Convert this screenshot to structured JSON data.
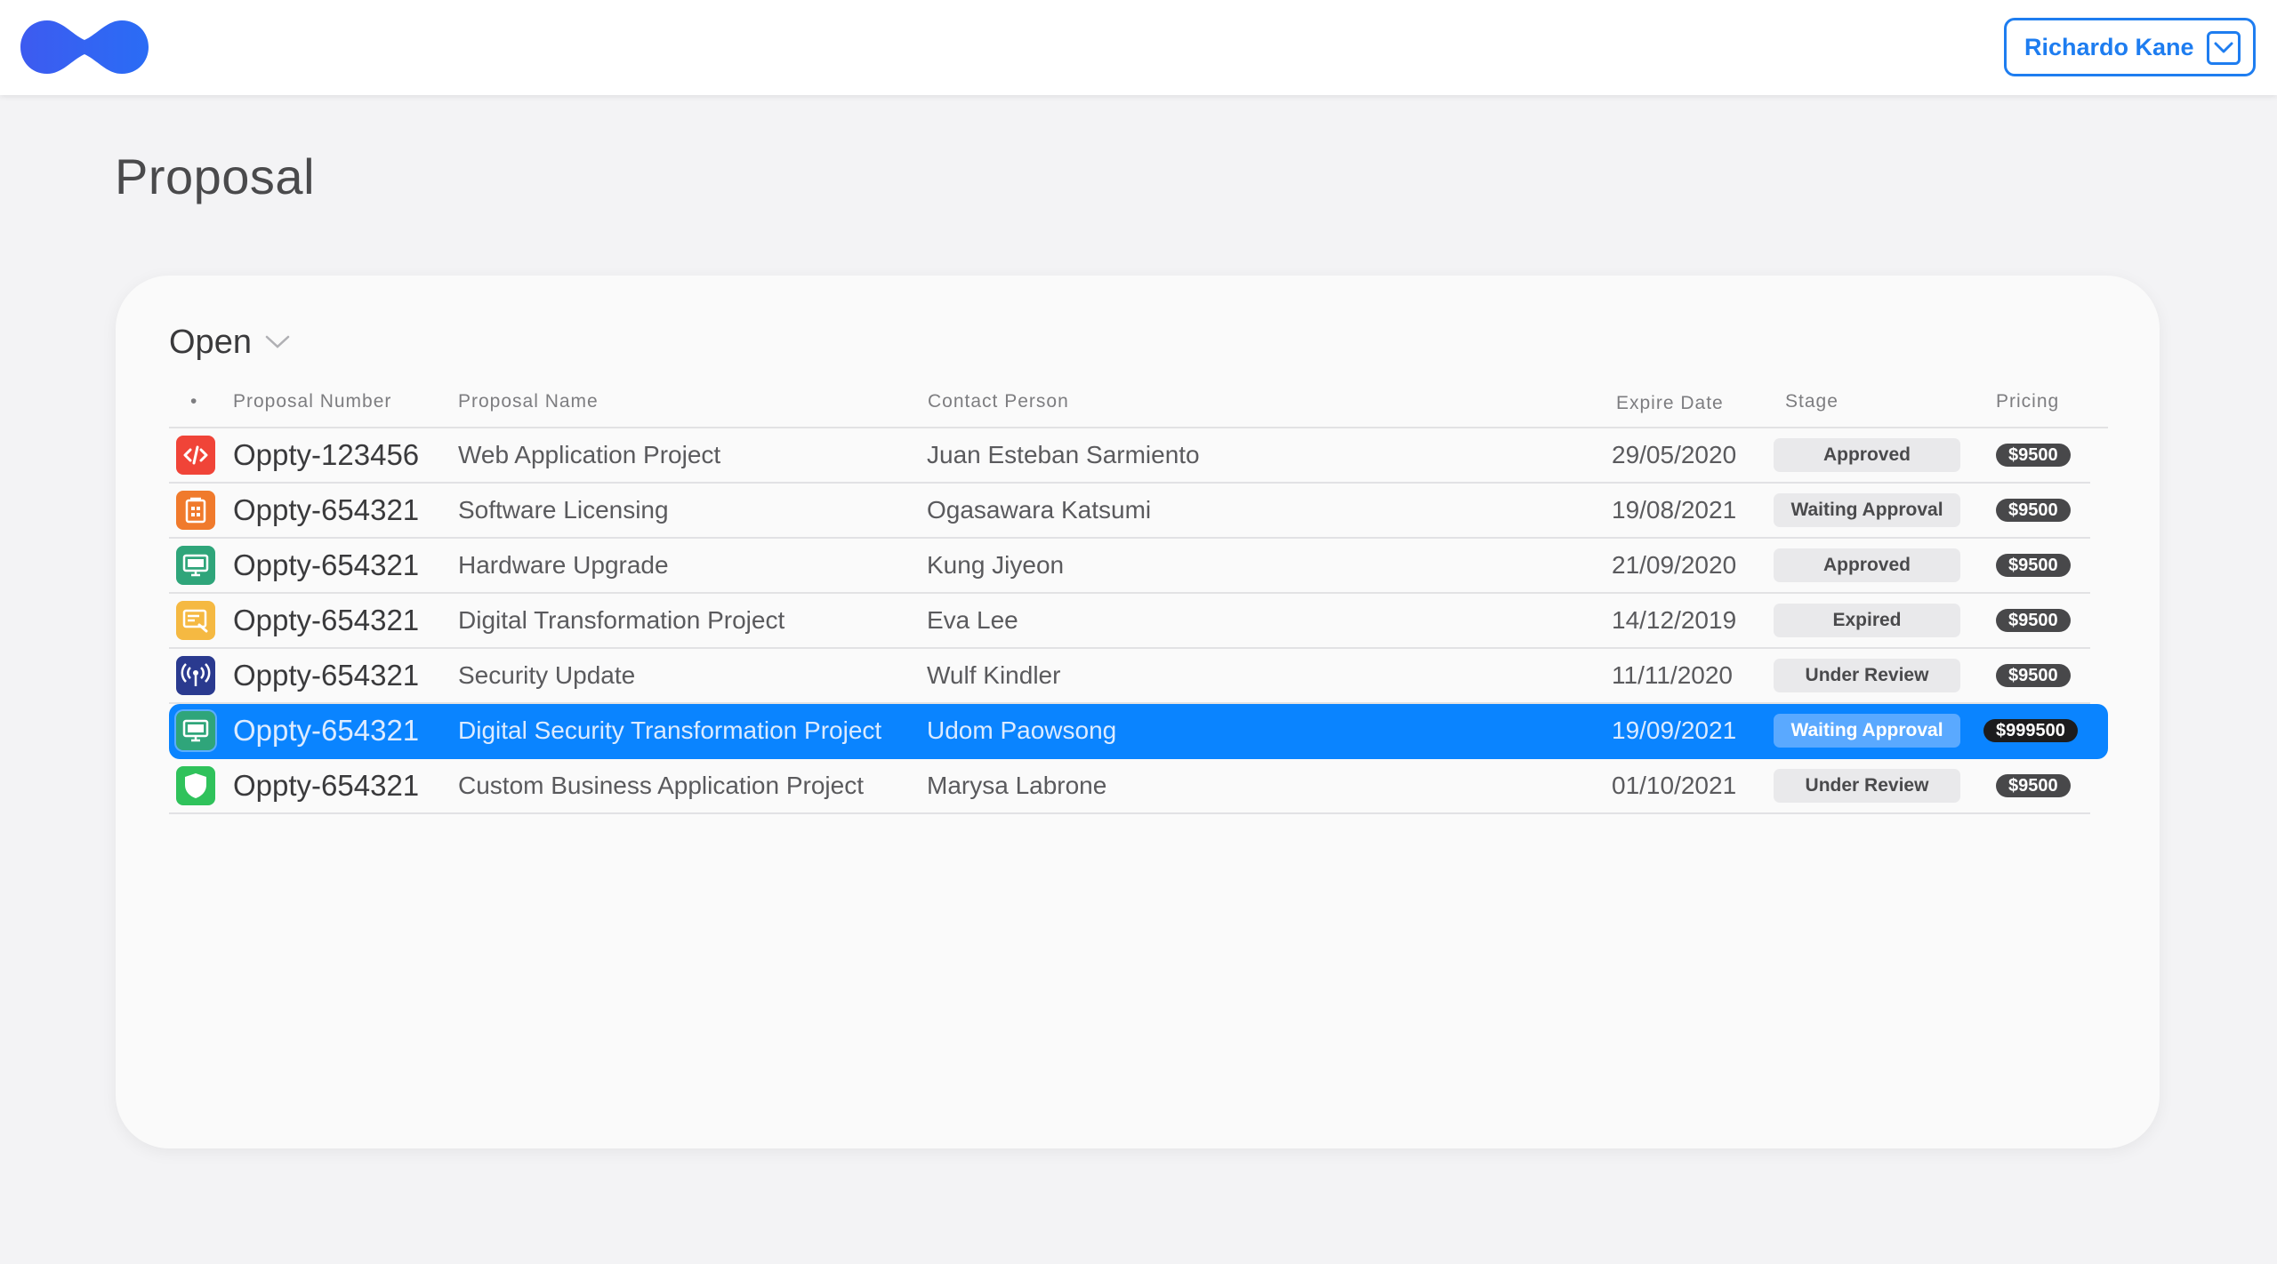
{
  "header": {
    "user_name": "Richardo Kane"
  },
  "page": {
    "title": "Proposal"
  },
  "filter": {
    "selected": "Open"
  },
  "table": {
    "columns": {
      "bullet": "•",
      "number": "Proposal Number",
      "name": "Proposal Name",
      "contact": "Contact Person",
      "expire": "Expire Date",
      "stage": "Stage",
      "pricing": "Pricing"
    },
    "rows": [
      {
        "icon": "code-icon",
        "icon_color": "#f04438",
        "number": "Oppty-123456",
        "name": "Web Application Project",
        "contact": "Juan Esteban Sarmiento",
        "expire": "29/05/2020",
        "stage": "Approved",
        "pricing": "$9500"
      },
      {
        "icon": "license-icon",
        "icon_color": "#f07a2c",
        "number": "Oppty-654321",
        "name": "Software Licensing",
        "contact": "Ogasawara Katsumi",
        "expire": "19/08/2021",
        "stage": "Waiting Approval",
        "pricing": "$9500"
      },
      {
        "icon": "monitor-icon",
        "icon_color": "#2fa57a",
        "number": "Oppty-654321",
        "name": "Hardware Upgrade",
        "contact": "Kung Jiyeon",
        "expire": "21/09/2020",
        "stage": "Approved",
        "pricing": "$9500"
      },
      {
        "icon": "screen-edit-icon",
        "icon_color": "#f5b942",
        "number": "Oppty-654321",
        "name": "Digital Transformation Project",
        "contact": "Eva Lee",
        "expire": "14/12/2019",
        "stage": "Expired",
        "pricing": "$9500"
      },
      {
        "icon": "broadcast-icon",
        "icon_color": "#2a3a8f",
        "number": "Oppty-654321",
        "name": "Security Update",
        "contact": "Wulf Kindler",
        "expire": "11/11/2020",
        "stage": "Under Review",
        "pricing": "$9500"
      },
      {
        "icon": "monitor-icon",
        "icon_color": "#2fa57a",
        "number": "Oppty-654321",
        "name": "Digital Security Transformation Project",
        "contact": "Udom Paowsong",
        "expire": "19/09/2021",
        "stage": "Waiting Approval",
        "pricing": "$999500",
        "selected": true
      },
      {
        "icon": "shield-icon",
        "icon_color": "#2fc25b",
        "number": "Oppty-654321",
        "name": "Custom Business Application Project",
        "contact": "Marysa Labrone",
        "expire": "01/10/2021",
        "stage": "Under Review",
        "pricing": "$9500"
      }
    ]
  },
  "colors": {
    "accent": "#0a84ff",
    "background": "#f3f3f5"
  }
}
